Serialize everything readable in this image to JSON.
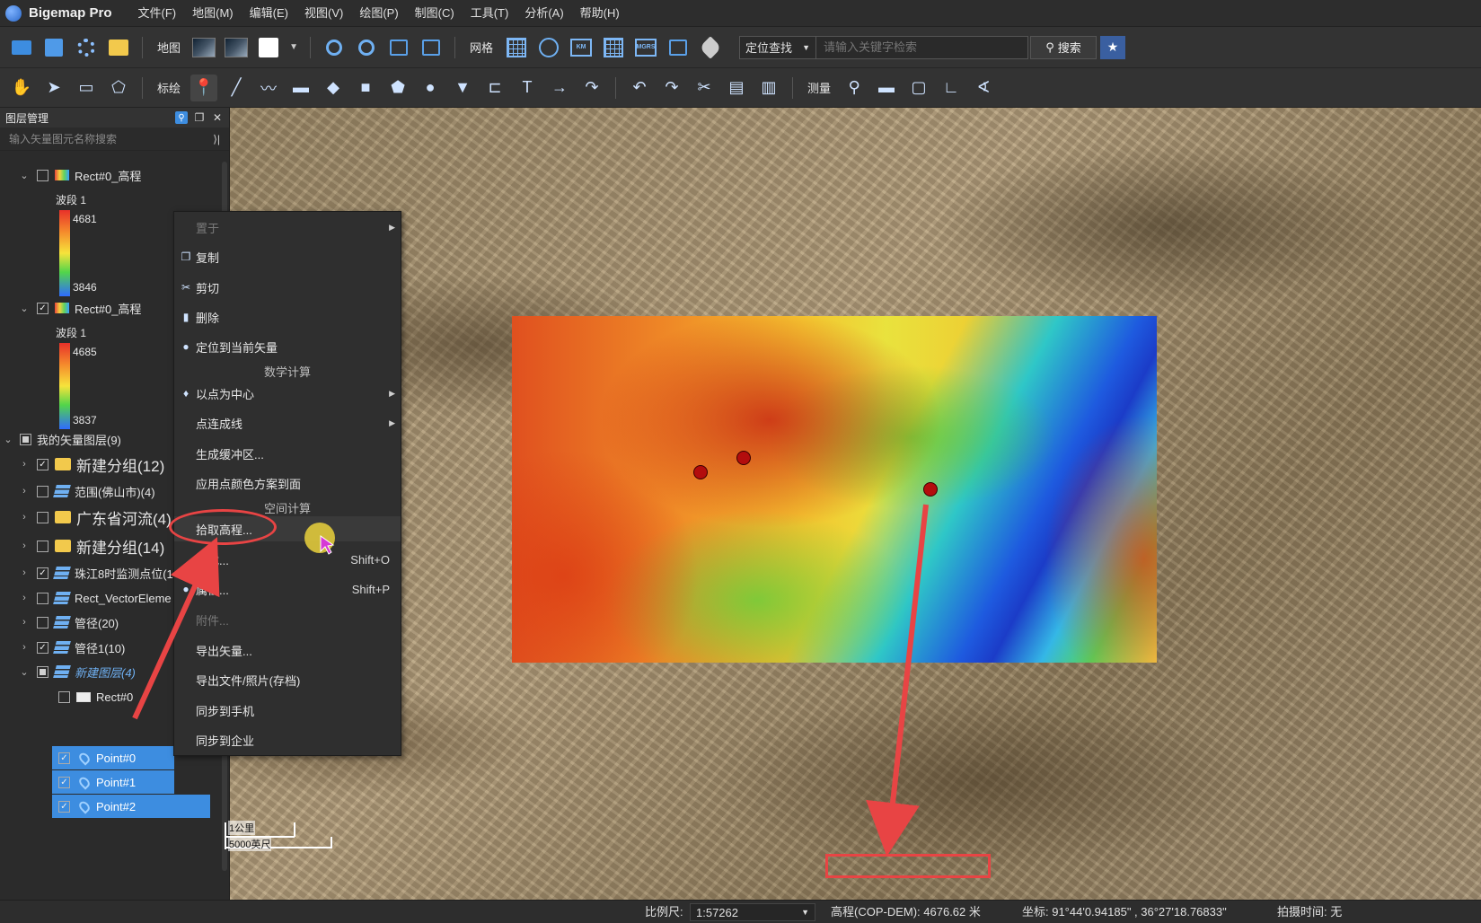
{
  "app": {
    "title": "Bigemap Pro"
  },
  "menu": [
    "文件(F)",
    "地图(M)",
    "编辑(E)",
    "视图(V)",
    "绘图(P)",
    "制图(C)",
    "工具(T)",
    "分析(A)",
    "帮助(H)"
  ],
  "toolbar1": {
    "map_label": "地图",
    "grid_label": "网格",
    "locate_select": "定位查找",
    "search_placeholder": "请输入关键字检索",
    "search_button": "搜索",
    "grid_icon_labels": [
      "KM",
      "MGRS"
    ]
  },
  "toolbar2": {
    "annotate_label": "标绘",
    "measure_label": "测量"
  },
  "layer_panel": {
    "title": "图层管理",
    "search_placeholder": "输入矢量图元名称搜索",
    "raster1": {
      "name": "Rect#0_高程",
      "band": "波段 1",
      "max": "4681",
      "min": "3846",
      "checked": false
    },
    "raster2": {
      "name": "Rect#0_高程",
      "band": "波段 1",
      "max": "4685",
      "min": "3837",
      "checked": true
    },
    "vector_root": "我的矢量图层(9)",
    "items": [
      {
        "name": "新建分组(12)",
        "icon": "folder-icon",
        "checked": true
      },
      {
        "name": "范围(佛山市)(4)",
        "icon": "layer-icon",
        "checked": false
      },
      {
        "name": "广东省河流(4)",
        "icon": "folder-icon",
        "checked": false
      },
      {
        "name": "新建分组(14)",
        "icon": "folder-icon",
        "checked": false
      },
      {
        "name": "珠江8时监测点位(1",
        "icon": "layer-icon",
        "checked": true
      },
      {
        "name": "Rect_VectorEleme",
        "icon": "layer-icon",
        "checked": false
      },
      {
        "name": "管径(20)",
        "icon": "layer-icon",
        "checked": false
      },
      {
        "name": "管径1(10)",
        "icon": "layer-icon",
        "checked": true
      },
      {
        "name": "新建图层(4)",
        "icon": "layer-icon",
        "checked": "partial"
      }
    ],
    "children": [
      {
        "name": "Rect#0",
        "checked": false
      },
      {
        "name": "Point#0",
        "checked": true
      },
      {
        "name": "Point#1",
        "checked": true
      },
      {
        "name": "Point#2",
        "checked": true
      }
    ]
  },
  "context_menu": {
    "place": "置于",
    "copy": "复制",
    "cut": "剪切",
    "delete": "删除",
    "locate": "定位到当前矢量",
    "math_header": "数学计算",
    "center": "以点为中心",
    "connect": "点连成线",
    "buffer": "生成缓冲区...",
    "apply_color": "应用点颜色方案到面",
    "spatial_header": "空间计算",
    "pick_elevation": "拾取高程...",
    "style": "样式...",
    "style_shortcut": "Shift+O",
    "props": "属性...",
    "props_shortcut": "Shift+P",
    "attach": "附件...",
    "export_vector": "导出矢量...",
    "export_file": "导出文件/照片(存档)",
    "sync_phone": "同步到手机",
    "sync_company": "同步到企业"
  },
  "map": {
    "scale_km": "1公里",
    "scale_ft": "5000英尺"
  },
  "status": {
    "scale_label": "比例尺:",
    "scale_value": "1:57262",
    "elevation": "高程(COP-DEM): 4676.62 米",
    "coord": "坐标: 91°44'0.94185\" , 36°27'18.76833\"",
    "capture_time": "拍摄时间: 无"
  },
  "colors": {
    "annotation_red": "#e84444",
    "selection_blue": "#3d8de0"
  }
}
